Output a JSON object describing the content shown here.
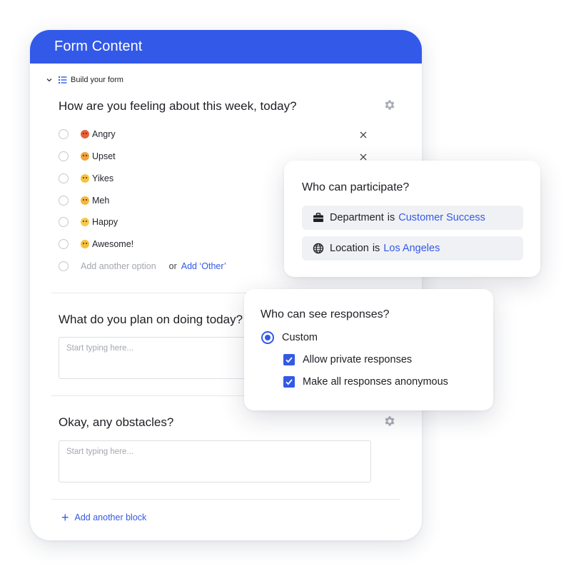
{
  "form": {
    "title": "Form Content",
    "section_label": "Build your form",
    "questions": [
      {
        "title": "How are you feeling about this week, today?",
        "options": [
          {
            "emoji_color": "#e8613a",
            "label": "Angry"
          },
          {
            "emoji_color": "#f2a23a",
            "label": "Upset"
          },
          {
            "emoji_color": "#f7c23e",
            "label": "Yikes"
          },
          {
            "emoji_color": "#f5b73c",
            "label": "Meh"
          },
          {
            "emoji_color": "#f7c84a",
            "label": "Happy"
          },
          {
            "emoji_color": "#f6bf3b",
            "label": "Awesome!"
          }
        ],
        "add_option_placeholder": "Add another option",
        "or_text": "or",
        "add_other_label": "Add ‘Other’"
      },
      {
        "title": "What do you plan on doing today?",
        "placeholder": "Start typing here..."
      },
      {
        "title": "Okay, any obstacles?",
        "placeholder": "Start typing here..."
      }
    ],
    "add_block_label": "Add another block"
  },
  "participate": {
    "title": "Who can participate?",
    "rules": [
      {
        "icon": "briefcase-icon",
        "field": "Department",
        "op": "is",
        "value": "Customer Success"
      },
      {
        "icon": "globe-icon",
        "field": "Location",
        "op": "is",
        "value": "Los Angeles"
      }
    ]
  },
  "responses": {
    "title": "Who can see responses?",
    "mode_label": "Custom",
    "allow_private_label": "Allow private responses",
    "anonymous_label": "Make all responses anonymous"
  },
  "colors": {
    "accent": "#3359e8",
    "header_bg": "#3359e8",
    "pill_bg": "#f0f1f4"
  }
}
